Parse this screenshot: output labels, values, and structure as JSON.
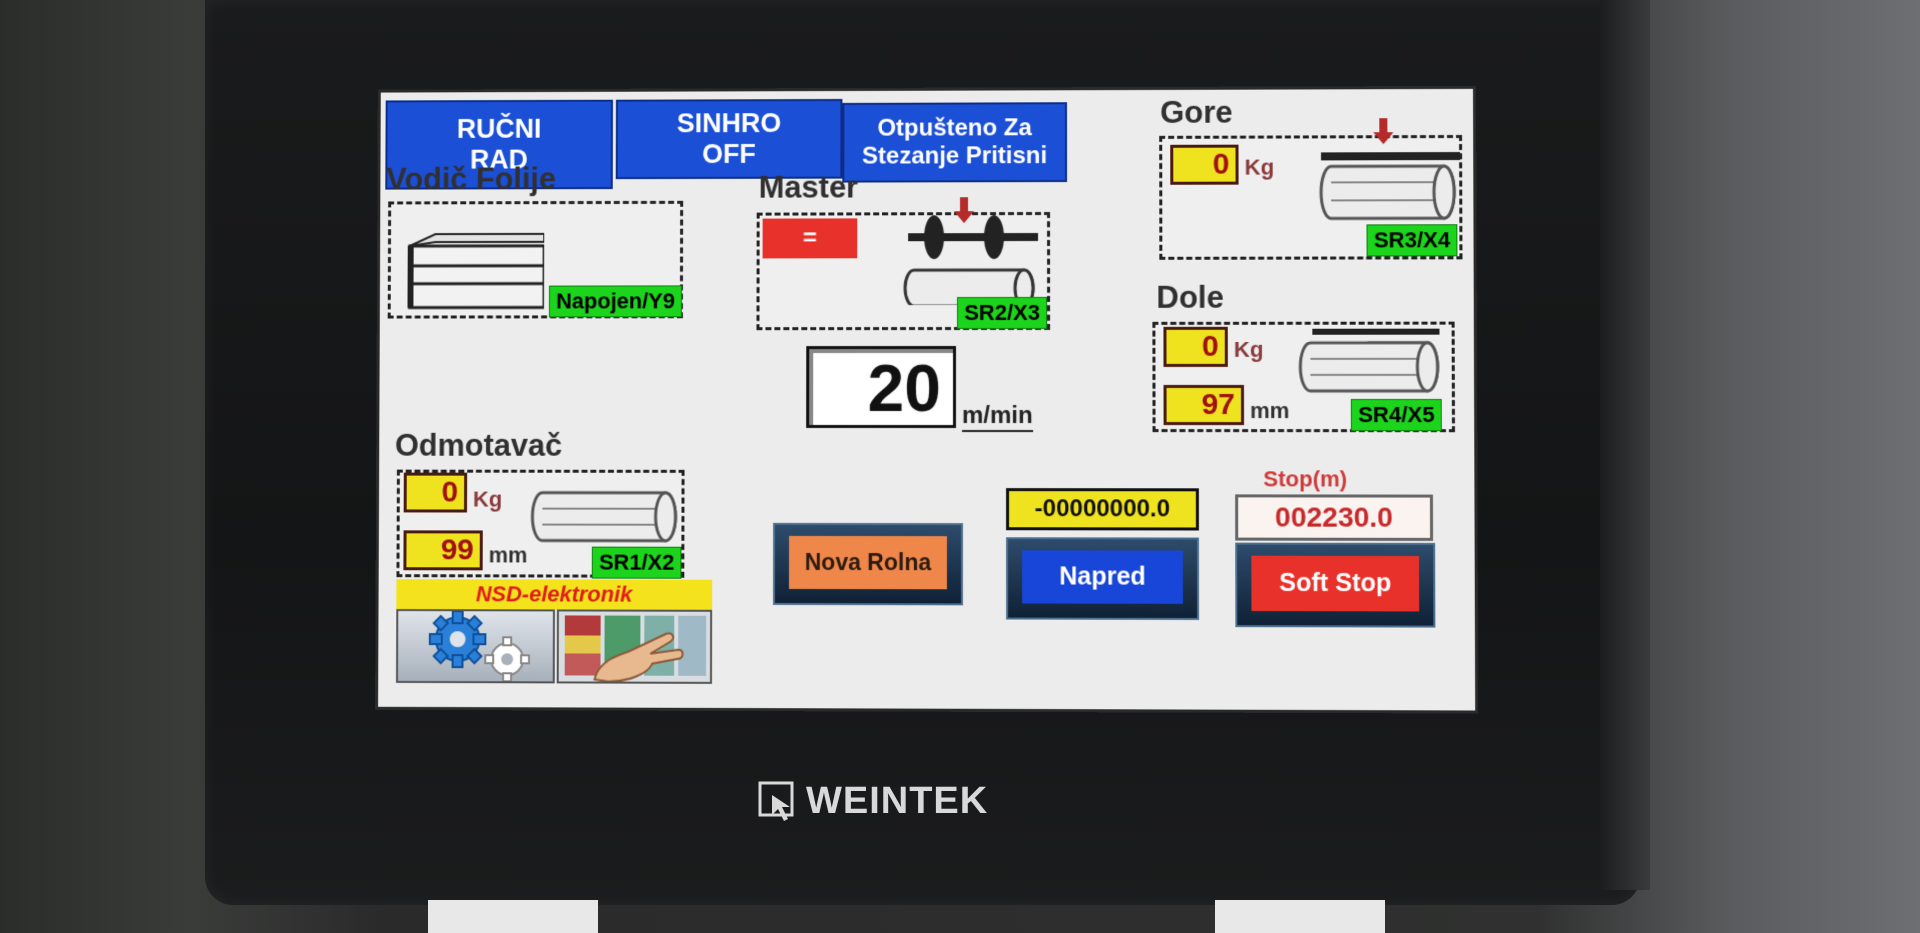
{
  "device": {
    "brand": "WEINTEK"
  },
  "top_buttons": [
    {
      "label": "RUČNI\nRAD"
    },
    {
      "label": "SINHRO\nOFF"
    },
    {
      "label": "Otpušteno Za\nStezanje Pritisni"
    }
  ],
  "vodic": {
    "title": "Vodič Folije",
    "status": "Napojen/Y9"
  },
  "master": {
    "title": "Master",
    "indicator": "=",
    "status": "SR2/X3"
  },
  "speed": {
    "value": "20",
    "unit": "m/min"
  },
  "gore": {
    "title": "Gore",
    "weight": "0",
    "weight_unit": "Kg",
    "status": "SR3/X4"
  },
  "dole": {
    "title": "Dole",
    "weight": "0",
    "weight_unit": "Kg",
    "diameter": "97",
    "diameter_unit": "mm",
    "status": "SR4/X5"
  },
  "odmotavac": {
    "title": "Odmotavač",
    "weight": "0",
    "weight_unit": "Kg",
    "diameter": "99",
    "diameter_unit": "mm",
    "status": "SR1/X2"
  },
  "brand_bar": "NSD-elektronik",
  "counter": {
    "value": "-00000000.0"
  },
  "stop": {
    "label": "Stop(m)",
    "value": "002230.0"
  },
  "buttons": {
    "nova_rolna": "Nova Rolna",
    "napred": "Napred",
    "soft_stop": "Soft Stop"
  },
  "colors": {
    "accent_blue": "#1b4fd6",
    "status_green": "#1cd41c",
    "value_yellow": "#efe21e",
    "alarm_red": "#e8312a",
    "orange": "#f0874a"
  }
}
